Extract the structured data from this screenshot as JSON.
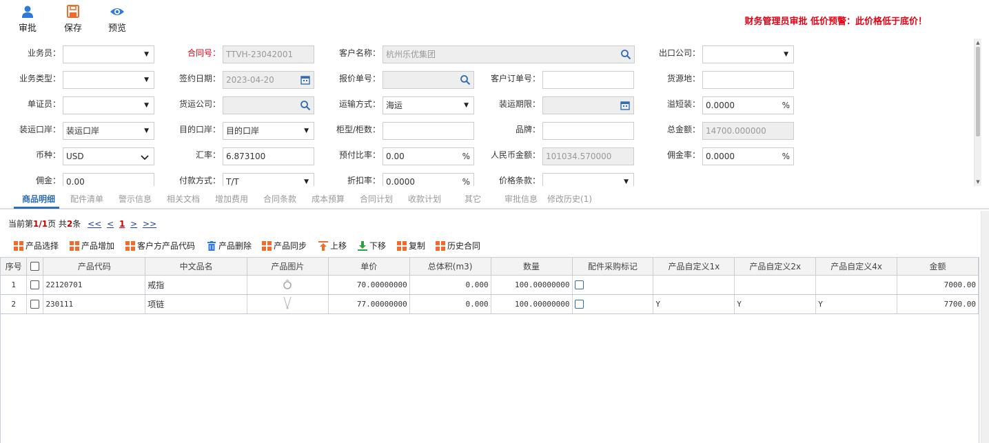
{
  "toolbar": {
    "approve_label": "审批",
    "save_label": "保存",
    "preview_label": "预览",
    "warning": "财务管理员审批  低价预警：此价格低于底价！"
  },
  "form": {
    "salesperson": {
      "label": "业务员：",
      "value": ""
    },
    "contract_no": {
      "label": "合同号：",
      "value": "TTVH-23042001"
    },
    "customer_name": {
      "label": "客户名称：",
      "value": "杭州乐优集团"
    },
    "export_company": {
      "label": "出口公司：",
      "value": ""
    },
    "business_type": {
      "label": "业务类型：",
      "value": ""
    },
    "sign_date": {
      "label": "签约日期：",
      "value": "2023-04-20"
    },
    "quote_no": {
      "label": "报价单号：",
      "value": ""
    },
    "customer_order_no": {
      "label": "客户订单号：",
      "value": ""
    },
    "source_place": {
      "label": "货源地：",
      "value": ""
    },
    "doc_clerk": {
      "label": "单证员：",
      "value": ""
    },
    "forwarder": {
      "label": "货运公司：",
      "value": ""
    },
    "transport_mode": {
      "label": "运输方式：",
      "value": "海运"
    },
    "ship_deadline": {
      "label": "装运期限：",
      "value": ""
    },
    "overflow": {
      "label": "溢短装：",
      "value": "0.0000",
      "unit": "%"
    },
    "load_port": {
      "label": "装运口岸：",
      "value": "装运口岸"
    },
    "dest_port": {
      "label": "目的口岸：",
      "value": "目的口岸"
    },
    "container": {
      "label": "柜型/柜数：",
      "value": ""
    },
    "brand": {
      "label": "品牌：",
      "value": ""
    },
    "total_amount": {
      "label": "总金额：",
      "value": "14700.000000"
    },
    "currency": {
      "label": "币种：",
      "value": "USD"
    },
    "exchange_rate": {
      "label": "汇率：",
      "value": "6.873100"
    },
    "prepay_ratio": {
      "label": "预付比率：",
      "value": "0.00",
      "unit": "%"
    },
    "rmb_amount": {
      "label": "人民币金额：",
      "value": "101034.570000"
    },
    "commission_rate": {
      "label": "佣金率：",
      "value": "0.0000",
      "unit": "%"
    },
    "commission": {
      "label": "佣金：",
      "value": "0.00"
    },
    "payment_method": {
      "label": "付款方式：",
      "value": "T/T"
    },
    "discount_rate": {
      "label": "折扣率：",
      "value": "0.0000",
      "unit": "%"
    },
    "price_terms": {
      "label": "价格条款：",
      "value": ""
    }
  },
  "tabs": [
    {
      "label": "商品明细"
    },
    {
      "label": "配件清单"
    },
    {
      "label": "警示信息"
    },
    {
      "label": "相关文档"
    },
    {
      "label": "增加费用"
    },
    {
      "label": "合同条款"
    },
    {
      "label": "成本预算"
    },
    {
      "label": "合同计划"
    },
    {
      "label": "收款计划"
    },
    {
      "label": "其它"
    },
    {
      "label": "审批信息"
    },
    {
      "label": "修改历史(1)"
    }
  ],
  "pager": {
    "prefix": "当前第",
    "page": "1/1",
    "mid": "页 共",
    "count": "2",
    "suffix": "条",
    "first": "<<",
    "prev": "<",
    "current": "1",
    "next": ">",
    "last": ">>"
  },
  "grid_tools": [
    {
      "label": "产品选择"
    },
    {
      "label": "产品增加"
    },
    {
      "label": "客户方产品代码"
    },
    {
      "label": "产品删除"
    },
    {
      "label": "产品同步"
    },
    {
      "label": "上移"
    },
    {
      "label": "下移"
    },
    {
      "label": "复制"
    },
    {
      "label": "历史合同"
    }
  ],
  "columns": [
    "序号",
    "",
    "产品代码",
    "中文品名",
    "产品图片",
    "单价",
    "总体积(m3)",
    "数量",
    "配件采购标记",
    "产品自定义1x",
    "产品自定义2x",
    "产品自定义4x",
    "金额"
  ],
  "rows": [
    {
      "no": "1",
      "code": "22120701",
      "name": "戒指",
      "image": "ring",
      "price": "70.00000000",
      "volume": "0.000",
      "qty": "100.00000000",
      "c1": "",
      "c2": "",
      "c4": "",
      "amount": "7000.00"
    },
    {
      "no": "2",
      "code": "230111",
      "name": "项链",
      "image": "necklace",
      "price": "77.00000000",
      "volume": "0.000",
      "qty": "100.00000000",
      "c1": "Y",
      "c2": "Y",
      "c4": "Y",
      "amount": "7700.00"
    }
  ],
  "colors": {
    "warning": "#e60012",
    "accent": "#2f6cb3",
    "toolbar_icon": "#2f7ad8",
    "save_icon": "#ef6c2c"
  }
}
